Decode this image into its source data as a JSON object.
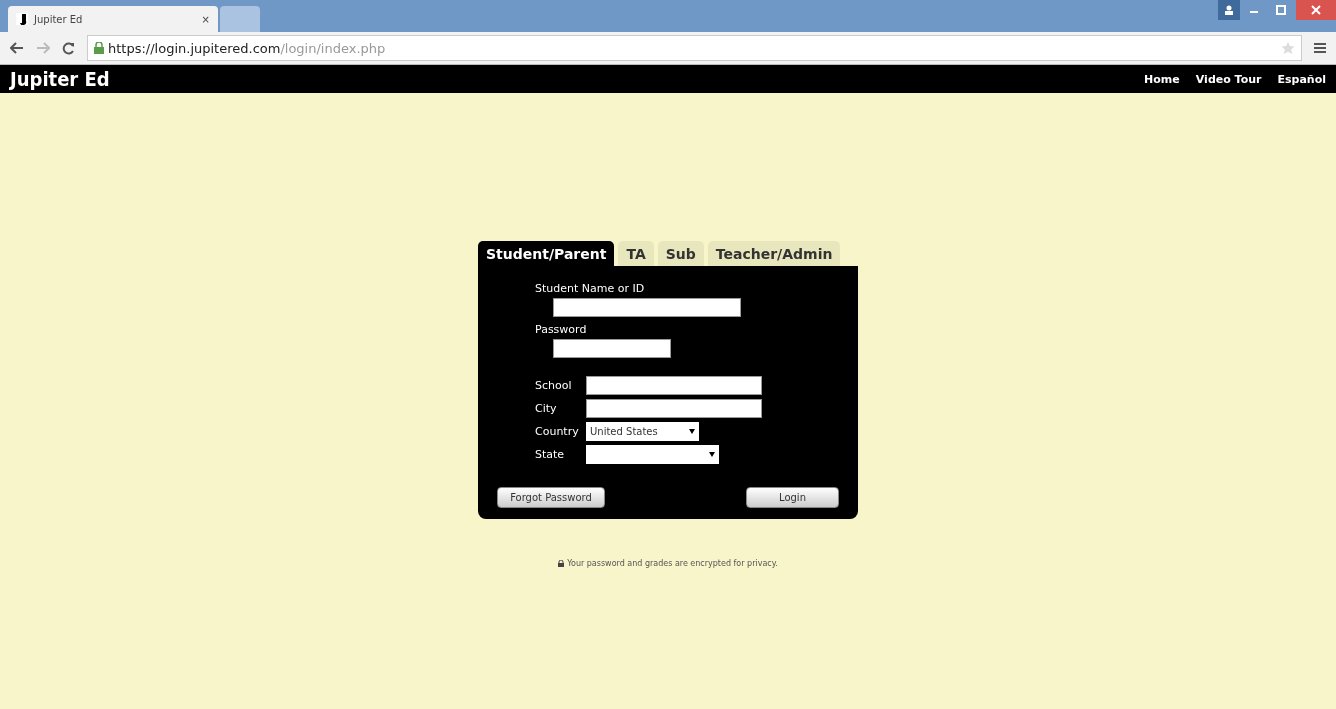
{
  "browser": {
    "tabs": [
      {
        "title": "Jupiter Ed",
        "selected": true
      },
      {
        "selected": false
      }
    ],
    "close_tab": "×",
    "url_host": "https://login.jupitered.com",
    "url_path": "/login/index.php"
  },
  "header": {
    "logo": "Jupiter Ed",
    "nav": [
      "Home",
      "Video Tour",
      "Español"
    ]
  },
  "login": {
    "tabs": [
      {
        "label": "Student/Parent",
        "selected": true
      },
      {
        "label": "TA",
        "selected": false
      },
      {
        "label": "Sub",
        "selected": false
      },
      {
        "label": "Teacher/Admin",
        "selected": false
      }
    ],
    "stacked_fields": [
      {
        "label": "Student Name or ID"
      },
      {
        "label": "Password"
      }
    ],
    "row_fields": [
      {
        "label": "School",
        "kind": "text"
      },
      {
        "label": "City",
        "kind": "text"
      },
      {
        "label": "Country",
        "kind": "select",
        "value": "United States"
      },
      {
        "label": "State",
        "kind": "select"
      }
    ],
    "buttons": [
      "Forgot Password",
      "Login"
    ]
  },
  "privacy_note": "Your password and grades are encrypted for privacy."
}
